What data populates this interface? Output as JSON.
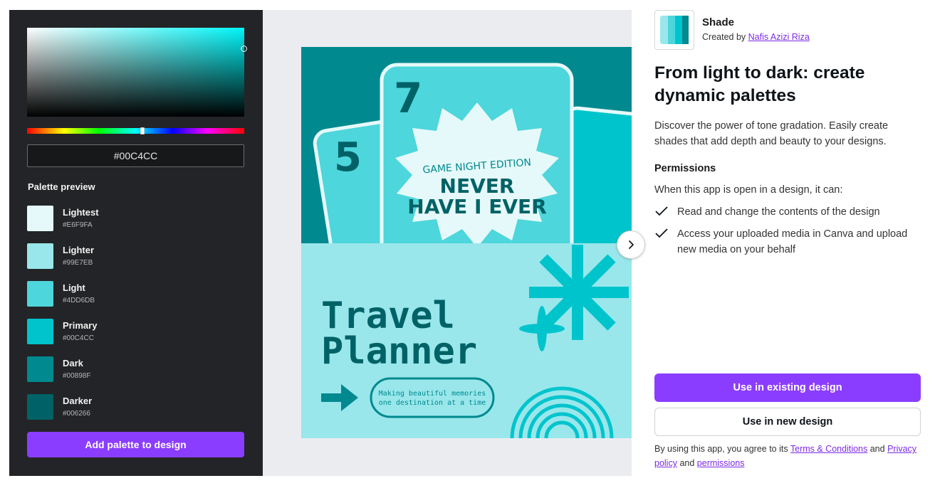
{
  "colors": {
    "accent": "#8b3dff",
    "panel_bg": "#232427",
    "link": "#7d2ae8"
  },
  "picker": {
    "hex_value": "#00C4CC",
    "palette_title": "Palette preview",
    "swatches": [
      {
        "name": "Lightest",
        "hex": "#E6F9FA"
      },
      {
        "name": "Lighter",
        "hex": "#99E7EB"
      },
      {
        "name": "Light",
        "hex": "#4DD6DB"
      },
      {
        "name": "Primary",
        "hex": "#00C4CC"
      },
      {
        "name": "Dark",
        "hex": "#00898F"
      },
      {
        "name": "Darker",
        "hex": "#006266"
      }
    ],
    "add_button": "Add palette to design"
  },
  "preview": {
    "card_back_number": "5",
    "card_front_number": "7",
    "edition_text": "GAME NIGHT EDITION",
    "title_line1": "NEVER",
    "title_line2": "HAVE I EVER",
    "travel_line1": "Travel",
    "travel_line2": "Planner",
    "tagline_line1": "Making beautiful memories",
    "tagline_line2": "one destination at a time",
    "next_icon": "chevron-right-icon"
  },
  "app": {
    "name": "Shade",
    "created_by_prefix": "Created by",
    "author": "Nafis Azizi Riza",
    "headline": "From light to dark: create dynamic palettes",
    "description": "Discover the power of tone gradation. Easily create shades that add depth and beauty to your designs.",
    "permissions_title": "Permissions",
    "permissions_intro": "When this app is open in a design, it can:",
    "permissions": [
      "Read and change the contents of the design",
      "Access your uploaded media in Canva and upload new media on your behalf"
    ],
    "primary_button": "Use in existing design",
    "secondary_button": "Use in new design",
    "legal": {
      "prefix": "By using this app, you agree to its",
      "terms": "Terms & Conditions",
      "and1": "and",
      "privacy": "Privacy policy",
      "and2": "and",
      "permissions_link": "permissions"
    }
  }
}
